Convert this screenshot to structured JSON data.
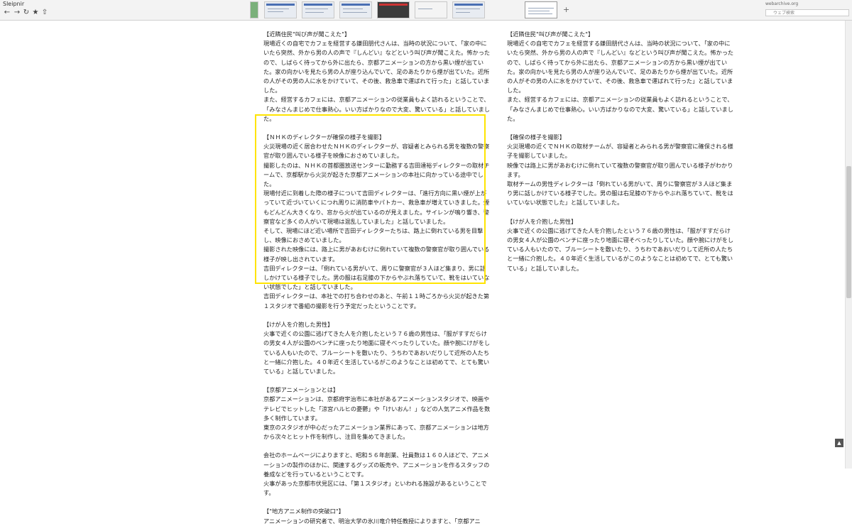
{
  "browser": {
    "name": "Sleipnir",
    "address": "webarchive.org",
    "search_placeholder": "ウェブ検索",
    "back_icon": "back-arrow-icon",
    "forward_icon": "forward-arrow-icon",
    "reload_icon": "reload-icon",
    "bookmark_icon": "star-icon",
    "share_icon": "share-icon",
    "new_tab": "+",
    "back_to_top": "▲"
  },
  "left_article": [
    {
      "id": "neighbors",
      "text": "【近隣住民\"叫び声が聞こえた\"】\n現場近くの自宅でカフェを経営する鎌田朋代さんは、当時の状況について、「家の中にいたら突然、外から男の人の声で『しんどい』などという叫び声が聞こえた。怖かったので、しばらく待ってから外に出たら、京都アニメーションの方から黒い煙が出ていた。家の向かいを見たら男の人が座り込んでいて、足のあたりから煙が出ていた。近所の人がその男の人に水をかけていて、その後、救急車で運ばれて行った」と話していました。\nまた、経営するカフェには、京都アニメーションの従業員もよく訪れるということで、「みなさんまじめで仕事熱心。いい方ばかりなので大変、驚いている」と話していました。"
    },
    {
      "id": "nhk",
      "text": "【ＮＨＫのディレクターが確保の様子を撮影】\n火災現場の近く居合わせたＮＨＫのディレクターが、容疑者とみられる男を複数の警察官が取り囲んでいる様子を映像におさめていました。\n撮影したのは、ＮＨＫの首都圏放送センターに勤務する吉田達裕ディレクターの取材チームで、京都駅から火災が起きた京都アニメーションの本社に向かっている途中でした。\n現場付近に到着した際の様子について吉田ディレクターは、「進行方向に黒い煙が上がっていて近づいていくにつれ周りに消防車やパトカー、救急車が増えていきました。煙もどんどん大きくなり、窓から火が出ているのが見えました。サイレンが鳴り響き、警察官など多くの人がいて現場は混乱していました」と話していました。\nそして、現場にほど近い場所で吉田ディレクターたちは、路上に倒れている男を目撃し、映像におさめていました。\n撮影された映像には、路上に男があおむけに倒れていて複数の警察官が取り囲んでいる様子が映し出されています。\n吉田ディレクターは、「倒れている男がいて、周りに警察官が３人ほど集まり、男に話しかけている様子でした。男の服は右足膝の下からやぶれ落ちていて、靴をはいていない状態でした」と話していました。\n吉田ディレクターは、本社での打ち合わせのあと、午前１１時ごろから火災が起きた第１スタジオで番組の撮影を行う予定だったということです。"
    },
    {
      "id": "injured",
      "text": "【けが人を介抱した男性】\n火事で近くの公園に逃げてきた人を介抱したという７６歳の男性は、「服がすすだらけの男女４人が公園のベンチに座ったり地面に寝そべったりしていた。顔や腕にけがをしている人もいたので、ブルーシートを敷いたり、うちわであおいだりして近所の人たちと一緒に介抱した。４０年近く生活しているがこのようなことは初めてで、とても驚いている」と話していました。"
    },
    {
      "id": "kyoani",
      "text": "【京都アニメーションとは】\n京都アニメーションは、京都府宇治市に本社があるアニメーションスタジオで、映画やテレビでヒットした「涼宮ハルヒの憂鬱」や「けいおん！」などの人気アニメ作品を数多く制作しています。\n東京のスタジオが中心だったアニメーション業界にあって、京都アニメーションは地方から次々とヒット作を制作し、注目を集めてきました。"
    },
    {
      "id": "homepage",
      "text": "会社のホームページによりますと、昭和５６年創業、社員数は１６０人ほどで、アニメーションの製作のほかに、関連するグッズの販売や、アニメーションを作るスタッフの養成などを行っているということです。\n火事があった京都市伏見区には、「第１スタジオ」といわれる施設があるということです。"
    },
    {
      "id": "breakthrough",
      "text": "【\"地方アニメ制作の突破口\"】\nアニメーションの研究者で、明治大学の氷川竜介特任教授によりますと、「京都アニ"
    }
  ],
  "right_article": [
    {
      "id": "neighbors-r",
      "text": "【近隣住民\"叫び声が聞こえた\"】\n現場近くの自宅でカフェを経営する鎌田朋代さんは、当時の状況について、「家の中にいたら突然、外から男の人の声で『しんどい』などという叫び声が聞こえた。怖かったので、しばらく待ってから外に出たら、京都アニメーションの方から黒い煙が出ていた。家の向かいを見たら男の人が座り込んでいて、足のあたりから煙が出ていた。近所の人がその男の人に水をかけていて、その後、救急車で運ばれて行った」と話していました。\nまた、経営するカフェには、京都アニメーションの従業員もよく訪れるということで、「みなさんまじめで仕事熱心。いい方ばかりなので大変、驚いている」と話していました。"
    },
    {
      "id": "secure-r",
      "text": "【確保の様子を撮影】\n火災現場の近くでＮＨＫの取材チームが、容疑者とみられる男が警察官に確保される様子を撮影していました。\n映像では路上に男があおむけに倒れていて複数の警察官が取り囲んでいる様子がわかります。\n取材チームの男性ディレクターは「倒れている男がいて、周りに警察官が３人ほど集まり男に話しかけている様子でした。男の服は右足膝の下からやぶれ落ちていて、靴をはいていない状態でした」と話していました。"
    },
    {
      "id": "injured-r",
      "text": "【けが人を介抱した男性】\n火事で近くの公園に逃げてきた人を介抱したという７６歳の男性は、「服がすすだらけの男女４人が公園のベンチに座ったり地面に寝そべったりしていた。顔や腕にけがをしている人もいたので、ブルーシートを敷いたり、うちわであおいだりして近所の人たちと一緒に介抱した。４０年近く生活しているがこのようなことは初めてで、とても驚いている」と話していました。"
    }
  ]
}
